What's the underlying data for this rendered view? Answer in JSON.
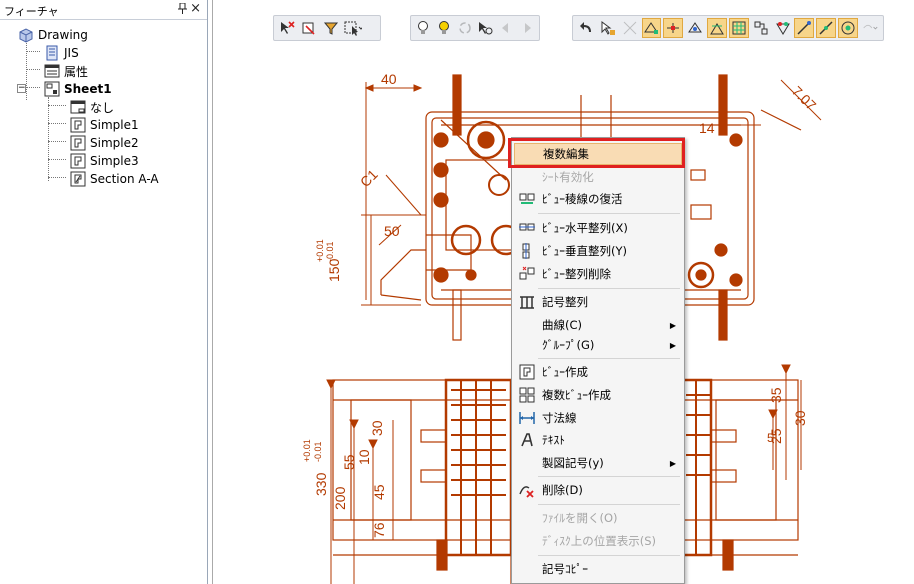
{
  "panel": {
    "title": "フィーチャ",
    "pin_glyph": "ᵖ",
    "close_glyph": "×",
    "tree": [
      {
        "label": "Drawing",
        "icon": "drawing-icon"
      },
      {
        "label": "JIS",
        "icon": "standard-icon"
      },
      {
        "label": "属性",
        "icon": "properties-icon"
      },
      {
        "label": "Sheet1",
        "icon": "sheet-icon"
      },
      {
        "label": "なし",
        "icon": "frame-icon"
      },
      {
        "label": "Simple1",
        "icon": "view-icon"
      },
      {
        "label": "Simple2",
        "icon": "view-icon"
      },
      {
        "label": "Simple3",
        "icon": "view-icon"
      },
      {
        "label": "Section A-A",
        "icon": "section-view-icon"
      }
    ]
  },
  "context_menu": {
    "items": [
      {
        "label": "複数編集",
        "state": "highlighted"
      },
      {
        "label": "ｼｰﾄ有効化",
        "state": "disabled"
      },
      {
        "label": "ﾋﾞｭｰ稜線の復活",
        "state": "normal"
      },
      {
        "label": "ﾋﾞｭｰ水平整列(X)",
        "state": "normal"
      },
      {
        "label": "ﾋﾞｭｰ垂直整列(Y)",
        "state": "normal"
      },
      {
        "label": "ﾋﾞｭｰ整列削除",
        "state": "normal"
      },
      {
        "label": "記号整列",
        "state": "normal"
      },
      {
        "label": "曲線(C)",
        "state": "submenu"
      },
      {
        "label": "ｸﾞﾙｰﾌﾟ(G)",
        "state": "submenu"
      },
      {
        "label": "ﾋﾞｭｰ作成",
        "state": "normal"
      },
      {
        "label": "複数ﾋﾞｭｰ作成",
        "state": "normal"
      },
      {
        "label": "寸法線",
        "state": "normal"
      },
      {
        "label": "ﾃｷｽﾄ",
        "state": "normal"
      },
      {
        "label": "製図記号(y)",
        "state": "submenu"
      },
      {
        "label": "削除(D)",
        "state": "normal"
      },
      {
        "label": "ﾌｧｲﾙを開く(O)",
        "state": "disabled"
      },
      {
        "label": "ﾃﾞｨｽｸ上の位置表示(S)",
        "state": "disabled"
      },
      {
        "label": "記号ｺﾋﾟｰ",
        "state": "normal"
      }
    ],
    "submenu_arrow": "▶"
  },
  "dimensions": {
    "d40": "40",
    "d14": "14",
    "d707": "7.07",
    "dc1": "C1",
    "d50": "50",
    "d150": "150",
    "tol1_plus": "+0.01",
    "tol1_minus": "-0.01",
    "d330": "330",
    "tol2_plus": "+0.01",
    "tol2_minus": "-0.01",
    "d200": "200",
    "d55": "55",
    "d10": "10",
    "d30": "30",
    "d45": "45",
    "d76": "76",
    "d35": "35",
    "d25": "25",
    "d30b": "30",
    "d5": "5"
  },
  "colors": {
    "drawing_line": "#b33a00",
    "highlight_border": "#e02020",
    "menu_highlight": "#f9dcb4"
  }
}
